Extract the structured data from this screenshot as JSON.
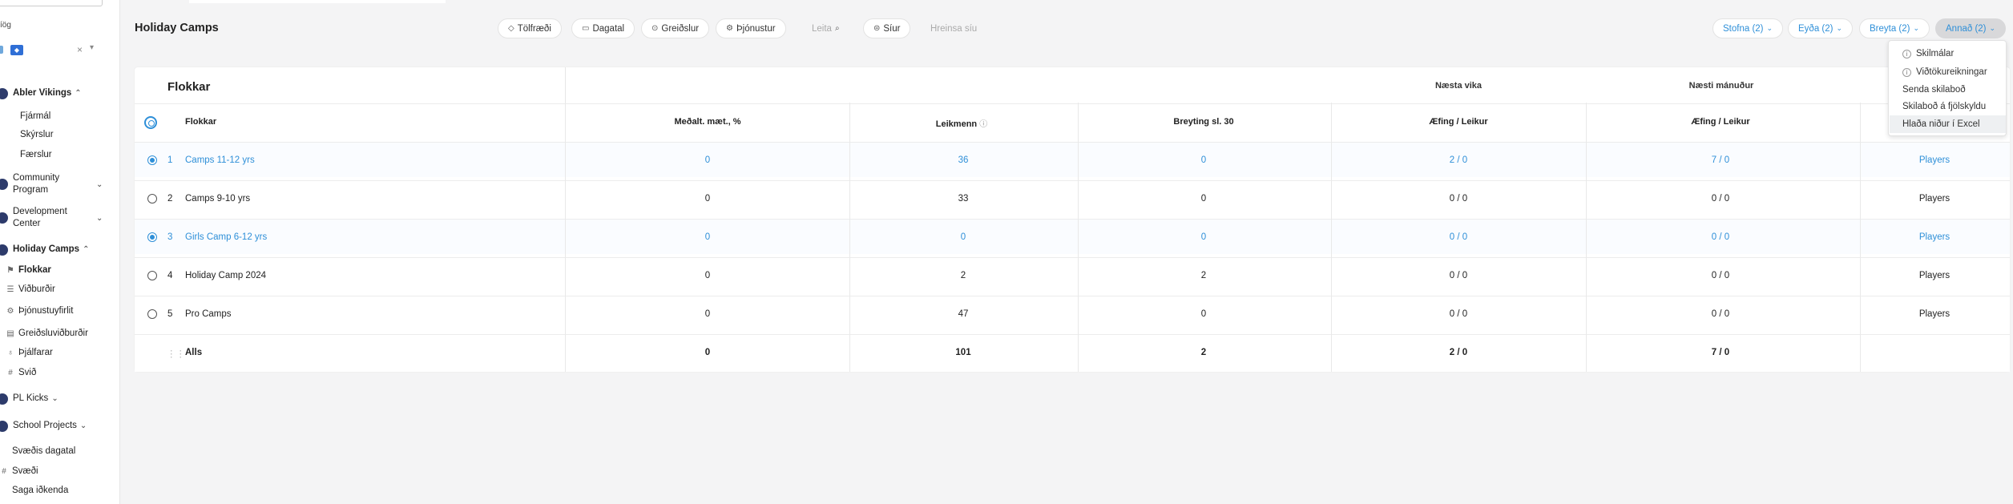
{
  "sidebar": {
    "label": "íög",
    "groups": [
      {
        "label": "Abler Vikings",
        "expanded": true,
        "items": [
          "Fjármál",
          "Skýrslur",
          "Færslur"
        ]
      },
      {
        "label_lines": [
          "Community",
          "Program"
        ]
      },
      {
        "label_lines": [
          "Development",
          "Center"
        ]
      },
      {
        "label": "Holiday Camps",
        "expanded": true,
        "items": [
          "Flokkar",
          "Viðburðir",
          "Þjónustuyfirlit",
          "Greiðsluviðburðir",
          "Þjálfarar",
          "Svið"
        ]
      },
      {
        "label": "PL Kicks"
      },
      {
        "label": "School Projects"
      }
    ],
    "footer_items": [
      "Svæðis dagatal",
      "Svæði",
      "Saga iðkenda"
    ]
  },
  "header": {
    "title": "Holiday Camps",
    "filters": [
      "Tölfræði",
      "Dagatal",
      "Greiðslur",
      "Þjónustur"
    ],
    "search_placeholder": "Leita",
    "filter_label": "Síur",
    "clear_label": "Hreinsa síu",
    "actions": [
      "Stofna (2)",
      "Eyða (2)",
      "Breyta (2)",
      "Annað (2)"
    ]
  },
  "table": {
    "title": "Flokkar",
    "group_headers": [
      "Næsta vika",
      "Næsti mánuður"
    ],
    "columns": [
      "Flokkar",
      "Meðalt. mæt., %",
      "Leikmenn",
      "Breyting sl. 30",
      "Æfing / Leikur",
      "Æfing / Leikur"
    ],
    "rows": [
      {
        "num": "1",
        "name": "Camps 11-12 yrs",
        "avg": "0",
        "players": "36",
        "change": "0",
        "week": "2 / 0",
        "month": "7 / 0",
        "link": "Players",
        "selected": true
      },
      {
        "num": "2",
        "name": "Camps 9-10 yrs",
        "avg": "0",
        "players": "33",
        "change": "0",
        "week": "0 / 0",
        "month": "0 / 0",
        "link": "Players",
        "selected": false
      },
      {
        "num": "3",
        "name": "Girls Camp 6-12 yrs",
        "avg": "0",
        "players": "0",
        "change": "0",
        "week": "0 / 0",
        "month": "0 / 0",
        "link": "Players",
        "selected": true
      },
      {
        "num": "4",
        "name": "Holiday Camp 2024",
        "avg": "0",
        "players": "2",
        "change": "2",
        "week": "0 / 0",
        "month": "0 / 0",
        "link": "Players",
        "selected": false
      },
      {
        "num": "5",
        "name": "Pro Camps",
        "avg": "0",
        "players": "47",
        "change": "0",
        "week": "0 / 0",
        "month": "0 / 0",
        "link": "Players",
        "selected": false
      }
    ],
    "total": {
      "label": "Alls",
      "avg": "0",
      "players": "101",
      "change": "2",
      "week": "2 / 0",
      "month": "7 / 0"
    }
  },
  "dropdown": {
    "items": [
      "Skilmálar",
      "Viðtökureikningar",
      "Senda skilaboð",
      "Skilaboð á fjölskyldu",
      "Hlaða niður í Excel"
    ]
  },
  "colors": {
    "accent": "#2e8fd8",
    "background": "#f4f4f5"
  }
}
